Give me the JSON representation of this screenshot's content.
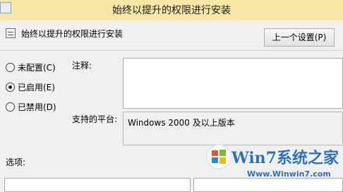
{
  "window": {
    "title": "始终以提升的权限进行安装"
  },
  "header": {
    "policy_title": "始终以提升的权限进行安装",
    "prev_button": "上一个设置(P)"
  },
  "options": [
    {
      "label": "未配置(C)",
      "checked": false
    },
    {
      "label": "已启用(E)",
      "checked": true
    },
    {
      "label": "已禁用(D)",
      "checked": false
    }
  ],
  "fields": {
    "comment_label": "注释:",
    "comment_value": "",
    "platform_label": "支持的平台:",
    "platform_value": "Windows 2000 及以上版本",
    "options_label": "选项:"
  },
  "watermark": {
    "brand": "Win7系统之家",
    "url": "Www.Winwin7.com"
  }
}
